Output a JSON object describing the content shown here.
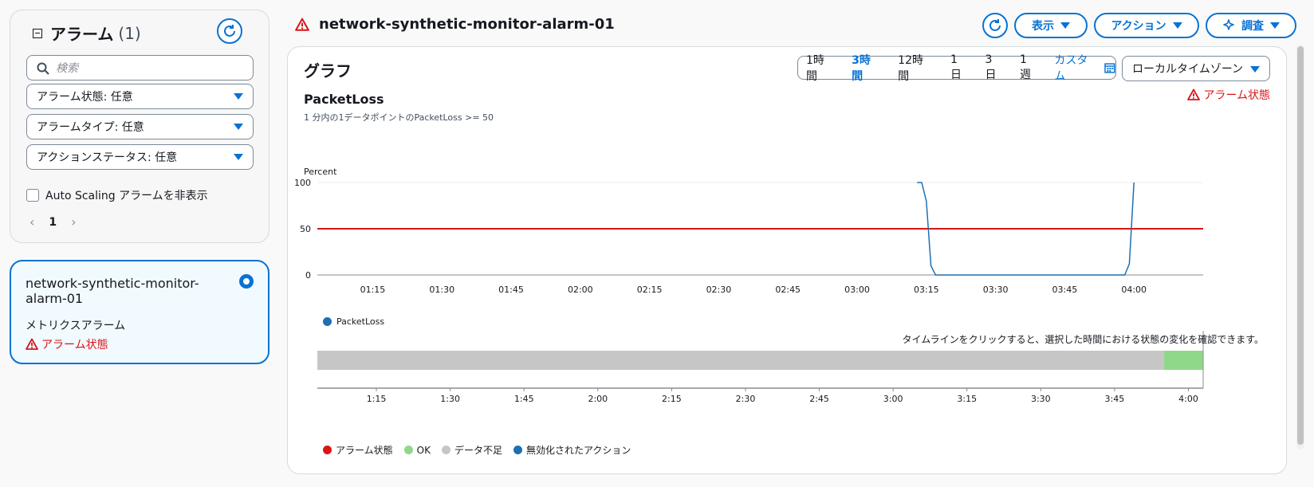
{
  "sidebar": {
    "title": "アラーム",
    "count": "(1)",
    "search_placeholder": "検索",
    "filters": [
      "アラーム状態: 任意",
      "アラームタイプ: 任意",
      "アクションステータス: 任意"
    ],
    "checkbox_label": "Auto Scaling アラームを非表示",
    "page": "1",
    "alarm": {
      "name": "network-synthetic-monitor-alarm-01",
      "type": "メトリクスアラーム",
      "state": "アラーム状態"
    }
  },
  "header": {
    "title": "network-synthetic-monitor-alarm-01",
    "buttons": {
      "view": "表示",
      "actions": "アクション",
      "investigate": "調査"
    }
  },
  "graph": {
    "title": "グラフ",
    "time_ranges": [
      "1時間",
      "3時間",
      "12時間",
      "1日",
      "3日",
      "1週"
    ],
    "active_range": "3時間",
    "custom": "カスタム",
    "timezone": "ローカルタイムゾーン",
    "metric_title": "PacketLoss",
    "metric_subtitle": "1 分内の1データポイントのPacketLoss >= 50",
    "alarm_state": "アラーム状態",
    "timeline_hint": "タイムラインをクリックすると、選択した時間における状態の変化を確認できます。",
    "colors": {
      "series": "#1f6fb2",
      "threshold": "#d91515",
      "ok": "#8fd889",
      "insufficient": "#c6c6c6",
      "alarm": "#d91515",
      "disabled": "#1f6fb2",
      "accent": "#0972d3"
    },
    "timeline_legend": [
      {
        "label": "アラーム状態",
        "color": "#d91515"
      },
      {
        "label": "OK",
        "color": "#8fd889"
      },
      {
        "label": "データ不足",
        "color": "#c6c6c6"
      },
      {
        "label": "無効化されたアクション",
        "color": "#1f6fb2"
      }
    ]
  },
  "chart_data": [
    {
      "type": "line",
      "ylabel": "Percent",
      "ylim": [
        0,
        100
      ],
      "yticks": [
        0,
        50,
        100
      ],
      "xlim": [
        "01:03",
        "04:15"
      ],
      "xticks": [
        "01:15",
        "01:30",
        "01:45",
        "02:00",
        "02:15",
        "02:30",
        "02:45",
        "03:00",
        "03:15",
        "03:30",
        "03:45",
        "04:00"
      ],
      "threshold": 50,
      "series": [
        {
          "name": "PacketLoss",
          "x": [
            "03:13",
            "03:14",
            "03:15",
            "03:16",
            "03:17",
            "03:18",
            "03:20",
            "03:30",
            "03:40",
            "03:50",
            "03:58",
            "03:59",
            "04:00"
          ],
          "values": [
            100,
            100,
            80,
            10,
            0,
            0,
            0,
            0,
            0,
            0,
            0,
            12,
            100
          ]
        }
      ],
      "legend": [
        "PacketLoss"
      ],
      "grid": true
    },
    {
      "type": "timeline",
      "xlim": [
        "01:03",
        "04:03"
      ],
      "xticks": [
        "1:15",
        "1:30",
        "1:45",
        "2:00",
        "2:15",
        "2:30",
        "2:45",
        "3:00",
        "3:15",
        "3:30",
        "3:45",
        "4:00"
      ],
      "segments": [
        {
          "state": "データ不足",
          "start": "01:03",
          "end": "03:55"
        },
        {
          "state": "OK",
          "start": "03:55",
          "end": "04:03"
        }
      ]
    }
  ]
}
